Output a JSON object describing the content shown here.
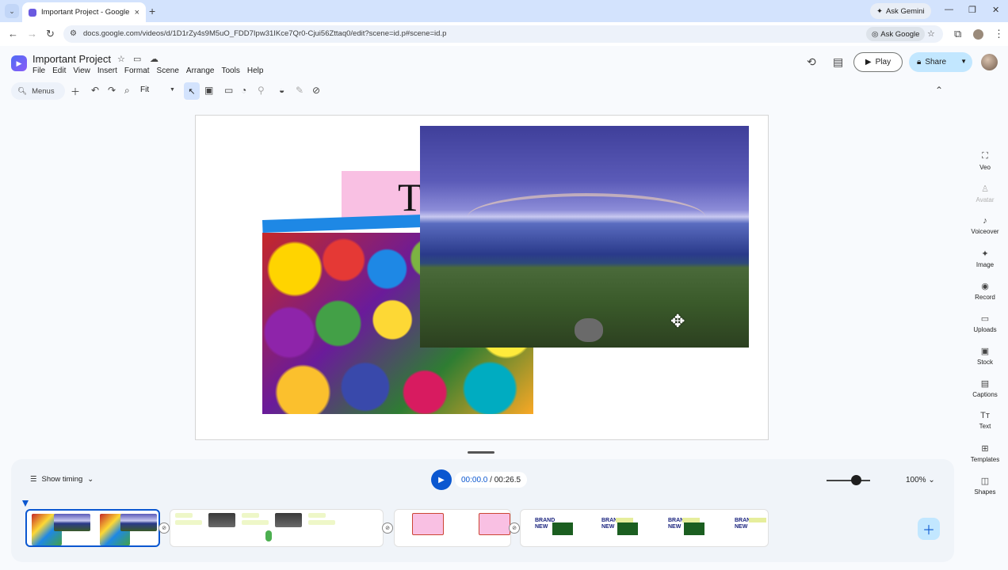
{
  "browser": {
    "tab_title": "Important Project - Google Vid",
    "tab_close": "×",
    "new_tab": "+",
    "ask_gemini": "Ask Gemini",
    "url": "docs.google.com/videos/d/1D1rZy4s9M5uO_FDD7Ipw31IKce7Qr0-Cjui56Zttaq0/edit?scene=id.p#scene=id.p",
    "ask_google": "Ask Google"
  },
  "app": {
    "title": "Important Project",
    "menu": [
      "File",
      "Edit",
      "View",
      "Insert",
      "Format",
      "Scene",
      "Arrange",
      "Tools",
      "Help"
    ],
    "play_label": "Play",
    "share_label": "Share"
  },
  "toolbar": {
    "menus_label": "Menus",
    "zoom": "Fit"
  },
  "canvas": {
    "big_letter": "T"
  },
  "rail": {
    "items": [
      {
        "label": "Veo",
        "icon": "veo-icon",
        "enabled": true
      },
      {
        "label": "Avatar",
        "icon": "avatar-icon",
        "enabled": false
      },
      {
        "label": "Voiceover",
        "icon": "voiceover-icon",
        "enabled": true
      },
      {
        "label": "Image",
        "icon": "image-icon",
        "enabled": true
      },
      {
        "label": "Record",
        "icon": "record-icon",
        "enabled": true
      },
      {
        "label": "Uploads",
        "icon": "folder-icon",
        "enabled": true
      },
      {
        "label": "Stock",
        "icon": "stock-icon",
        "enabled": true
      },
      {
        "label": "Captions",
        "icon": "captions-icon",
        "enabled": true
      },
      {
        "label": "Text",
        "icon": "text-icon",
        "enabled": true
      },
      {
        "label": "Templates",
        "icon": "templates-icon",
        "enabled": true
      },
      {
        "label": "Shapes",
        "icon": "shapes-icon",
        "enabled": true
      }
    ]
  },
  "timeline": {
    "show_timing": "Show timing",
    "current_time": "00:00.0",
    "separator": " / ",
    "total_time": "00:26.5",
    "zoom_pct": "100%",
    "brand_line1": "BRAND",
    "brand_line2": "NEW"
  },
  "colors": {
    "accent": "#0b57d0",
    "share_bg": "#c2e7ff",
    "pink": "#f9c0e3"
  }
}
